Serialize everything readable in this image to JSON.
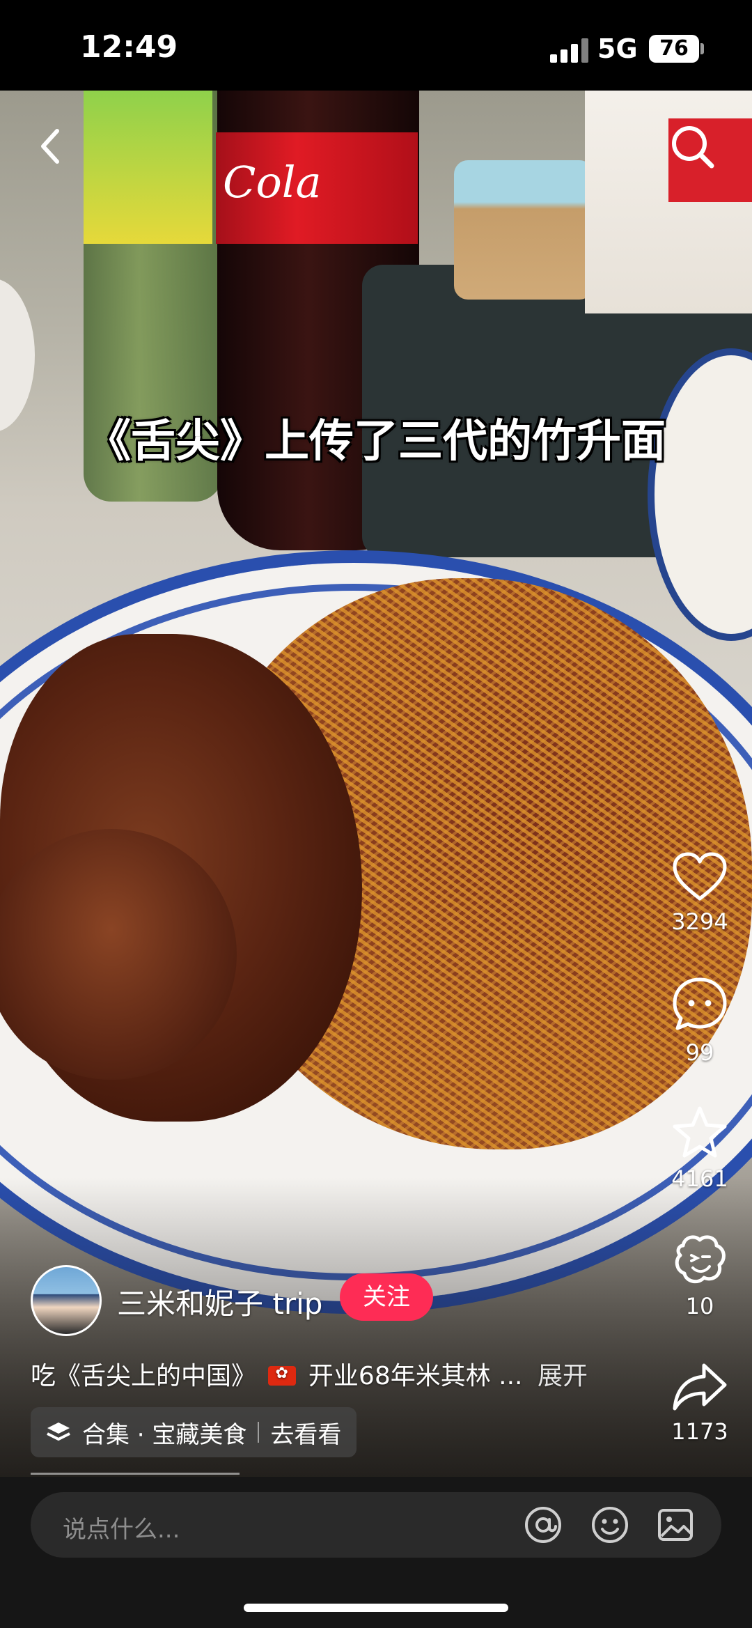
{
  "status_bar": {
    "time": "12:49",
    "network": "5G",
    "battery": "76"
  },
  "video": {
    "caption": "《舌尖》上传了三代的竹升面",
    "bottle_text": "Cola"
  },
  "actions": {
    "likes": "3294",
    "comments": "99",
    "favorites": "4161",
    "shares_special": "10",
    "shares": "1173"
  },
  "author": {
    "name": "三米和妮子 trip",
    "follow_label": "关注"
  },
  "description": {
    "text_before_flag": "吃《舌尖上的中国》",
    "text_after_flag": "开业68年米其林 ...",
    "expand_label": "展开"
  },
  "collection": {
    "label": "合集 · 宝藏美食",
    "action": "去看看"
  },
  "comment_bar": {
    "placeholder": "说点什么..."
  }
}
